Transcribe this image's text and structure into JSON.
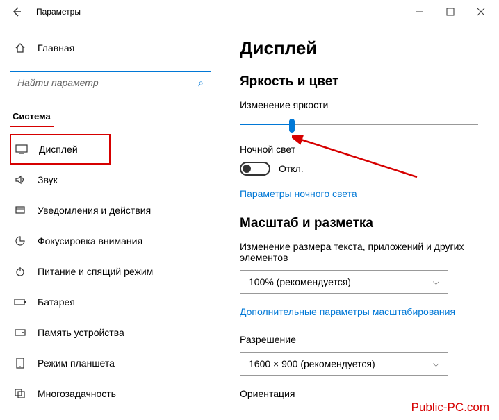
{
  "titlebar": {
    "title": "Параметры"
  },
  "sidebar": {
    "home": "Главная",
    "search_placeholder": "Найти параметр",
    "category": "Система",
    "items": [
      {
        "label": "Дисплей"
      },
      {
        "label": "Звук"
      },
      {
        "label": "Уведомления и действия"
      },
      {
        "label": "Фокусировка внимания"
      },
      {
        "label": "Питание и спящий режим"
      },
      {
        "label": "Батарея"
      },
      {
        "label": "Память устройства"
      },
      {
        "label": "Режим планшета"
      },
      {
        "label": "Многозадачность"
      }
    ]
  },
  "main": {
    "heading": "Дисплей",
    "brightness_section": "Яркость и цвет",
    "brightness_label": "Изменение яркости",
    "nightlight_label": "Ночной свет",
    "toggle_off": "Откл.",
    "nightlight_link": "Параметры ночного света",
    "scale_section": "Масштаб и разметка",
    "scale_label": "Изменение размера текста, приложений и других элементов",
    "scale_value": "100% (рекомендуется)",
    "scale_link": "Дополнительные параметры масштабирования",
    "resolution_label": "Разрешение",
    "resolution_value": "1600 × 900 (рекомендуется)",
    "orientation_label": "Ориентация"
  },
  "watermark": "Public-PC.com"
}
